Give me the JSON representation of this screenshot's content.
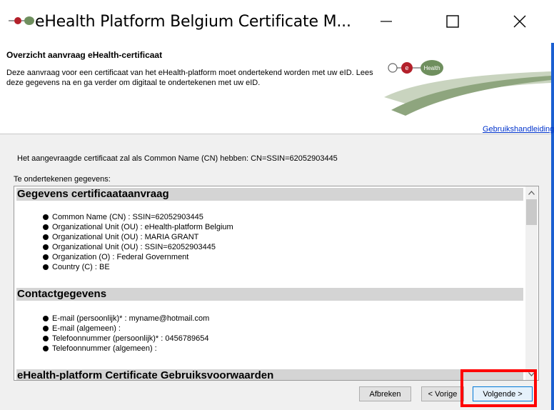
{
  "window": {
    "title": "eHealth Platform Belgium Certificate M...",
    "minimize_label": "—",
    "maximize_label": "☐",
    "close_label": "✕"
  },
  "header": {
    "title": "Overzicht aanvraag eHealth-certificaat",
    "description": "Deze aanvraag voor een certificaat van het eHealth-platform moet ondertekend worden met uw eID. Lees deze gegevens na en ga verder om digitaal te ondertekenen met uw eID.",
    "logo_text": "Health",
    "logo_letter": "e",
    "manual_link": "Gebruikshandleiding"
  },
  "main": {
    "cn_text": "Het aangevraagde certificaat zal als Common Name (CN) hebben:  CN=SSIN=62052903445",
    "to_sign_label": "Te ondertekenen gegevens:",
    "sections": [
      {
        "title": "Gegevens certificaataanvraag",
        "items": [
          "Common Name (CN) : SSIN=62052903445",
          "Organizational Unit (OU) : eHealth-platform Belgium",
          "Organizational Unit (OU) : MARIA GRANT",
          "Organizational Unit (OU) : SSIN=62052903445",
          "Organization (O) : Federal Government",
          "Country (C) : BE"
        ]
      },
      {
        "title": "Contactgegevens",
        "items": [
          "E-mail (persoonlijk)* : myname@hotmail.com",
          "E-mail (algemeen) :",
          "Telefoonnummer (persoonlijk)* : 0456789654",
          "Telefoonnummer (algemeen) :"
        ]
      },
      {
        "title": "eHealth-platform Certificate Gebruiksvoorwaarden"
      }
    ]
  },
  "buttons": {
    "cancel": "Afbreken",
    "previous": "< Vorige",
    "next": "Volgende >"
  },
  "colors": {
    "highlight": "#ff0000",
    "link": "#0033cc",
    "section_bg": "#d4d4d4",
    "logo_green": "#6f8f5e",
    "logo_red": "#b3202a"
  }
}
